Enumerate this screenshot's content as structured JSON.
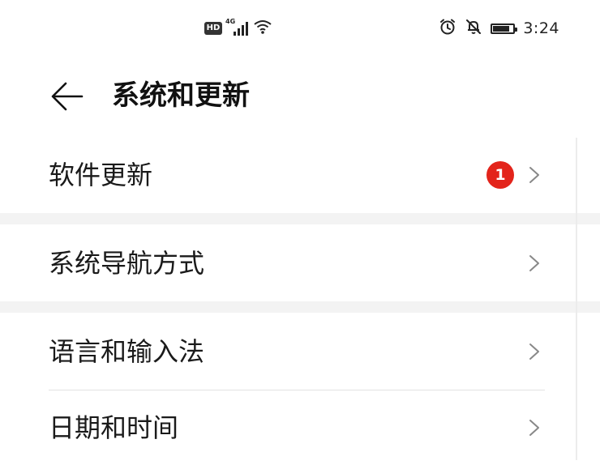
{
  "status_bar": {
    "hd_label": "HD",
    "network_label": "4G",
    "signal_icon": "signal-icon",
    "wifi_icon": "wifi-icon",
    "alarm_icon": "alarm-icon",
    "mute_icon": "bell-mute-icon",
    "battery_icon": "battery-icon",
    "battery_level": 0.8,
    "time": "3:24"
  },
  "header": {
    "back_icon": "arrow-left-icon",
    "title": "系统和更新"
  },
  "list": {
    "software_update": {
      "label": "软件更新",
      "badge": "1",
      "badge_color": "#e3241b"
    },
    "navigation": {
      "label": "系统导航方式"
    },
    "language": {
      "label": "语言和输入法"
    },
    "datetime": {
      "label": "日期和时间"
    }
  }
}
